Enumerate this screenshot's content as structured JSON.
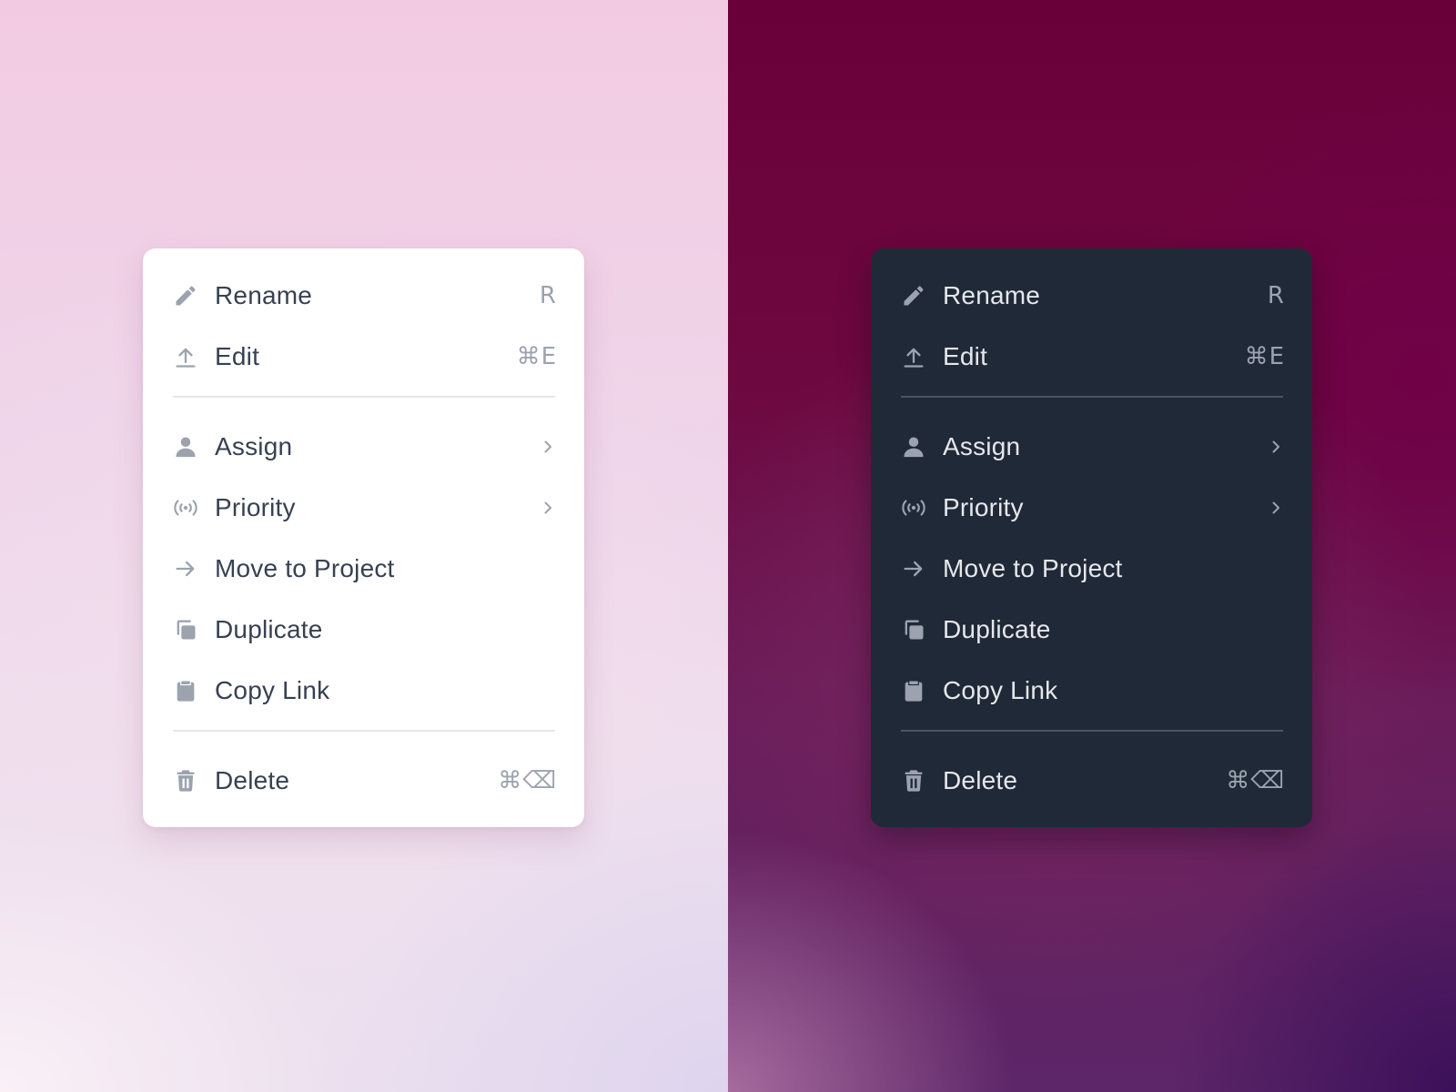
{
  "themes": [
    {
      "name": "light",
      "background_colors": [
        "#f2cbe2",
        "#ece0ef"
      ],
      "menu_background": "#ffffff",
      "text_color": "#374151",
      "icon_color": "#9ca3af"
    },
    {
      "name": "dark",
      "background_colors": [
        "#6a003a",
        "#3c105a"
      ],
      "menu_background": "#1f2937",
      "text_color": "#e5e7eb",
      "icon_color": "#9ca3af"
    }
  ],
  "menu": {
    "rename": {
      "label": "Rename",
      "shortcut": "R",
      "icon": "pencil-icon"
    },
    "edit": {
      "label": "Edit",
      "shortcut": "⌘E",
      "icon": "upload-icon"
    },
    "assign": {
      "label": "Assign",
      "icon": "user-icon",
      "submenu": true
    },
    "priority": {
      "label": "Priority",
      "icon": "signal-icon",
      "submenu": true
    },
    "move_to_project": {
      "label": "Move to Project",
      "icon": "arrow-right-icon"
    },
    "duplicate": {
      "label": "Duplicate",
      "icon": "duplicate-icon"
    },
    "copy_link": {
      "label": "Copy Link",
      "icon": "clipboard-icon"
    },
    "delete": {
      "label": "Delete",
      "shortcut": "⌘⌫",
      "icon": "trash-icon"
    }
  }
}
